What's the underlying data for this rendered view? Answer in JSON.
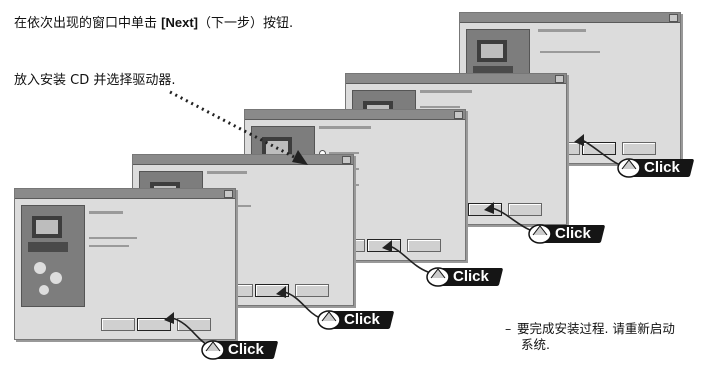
{
  "instructions": {
    "line1_prefix": "在依次出现的窗口中单击 ",
    "line1_button": "[Next]",
    "line1_suffix": "（下一步）按钮.",
    "cd_text": "放入安装 CD 并选择驱动器."
  },
  "click_label": "Click",
  "note": {
    "line1": "要完成安装过程. 请重新启动",
    "line2": "系统."
  },
  "windows": [
    {
      "name": "step-1"
    },
    {
      "name": "step-2"
    },
    {
      "name": "step-3"
    },
    {
      "name": "step-4"
    },
    {
      "name": "step-5"
    },
    {
      "name": "step-6"
    }
  ],
  "colors": {
    "window_bg": "#dcdcdc",
    "titlebar": "#8a8a8a",
    "badge": "#151515"
  },
  "icons": [
    "computer-illustration",
    "mouse-cursor-icon",
    "dotted-arrow"
  ]
}
